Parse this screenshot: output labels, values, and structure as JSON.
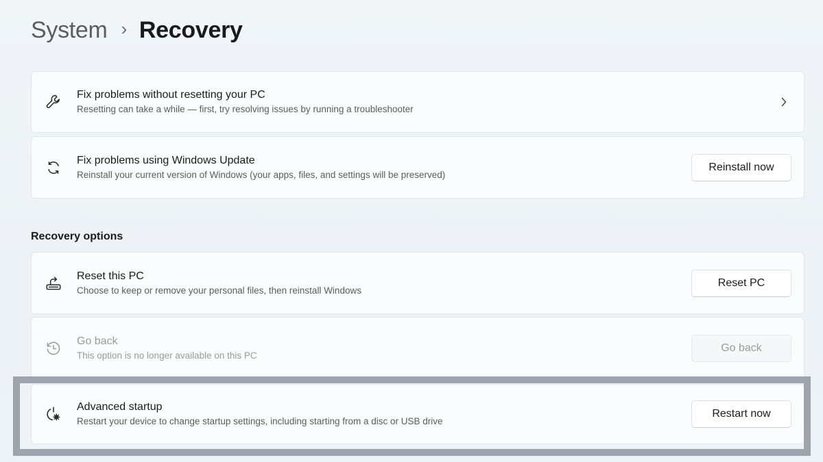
{
  "breadcrumb": {
    "parent": "System",
    "separator": "›",
    "current": "Recovery"
  },
  "cards": {
    "troubleshoot": {
      "icon": "wrench-icon",
      "title": "Fix problems without resetting your PC",
      "subtitle": "Resetting can take a while — first, try resolving issues by running a troubleshooter",
      "action": "chevron-right-icon"
    },
    "windows_update": {
      "icon": "sync-icon",
      "title": "Fix problems using Windows Update",
      "subtitle": "Reinstall your current version of Windows (your apps, files, and settings will be preserved)",
      "button": "Reinstall now"
    }
  },
  "recovery_options": {
    "heading": "Recovery options",
    "reset": {
      "icon": "reset-pc-icon",
      "title": "Reset this PC",
      "subtitle": "Choose to keep or remove your personal files, then reinstall Windows",
      "button": "Reset PC"
    },
    "go_back": {
      "icon": "history-icon",
      "title": "Go back",
      "subtitle": "This option is no longer available on this PC",
      "button": "Go back",
      "disabled": true
    },
    "advanced_startup": {
      "icon": "advanced-startup-icon",
      "title": "Advanced startup",
      "subtitle": "Restart your device to change startup settings, including starting from a disc or USB drive",
      "button": "Restart now",
      "highlighted": true
    }
  },
  "colors": {
    "background": "#eef3f7",
    "card": "#fbfcfd",
    "highlight_border": "#9fa3ab",
    "disabled_text": "#9a9a9a"
  }
}
